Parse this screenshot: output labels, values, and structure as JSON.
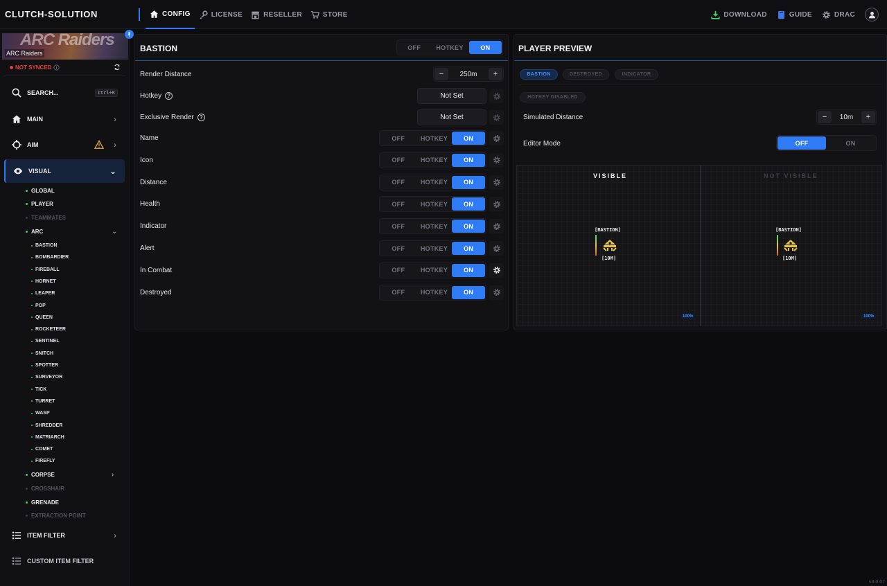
{
  "app": {
    "brand": "CLUTCH-SOLUTION",
    "version": "v3.0.07"
  },
  "nav": {
    "tabs": [
      {
        "label": "CONFIG",
        "icon": "home-icon",
        "active": true
      },
      {
        "label": "LICENSE",
        "icon": "key-icon"
      },
      {
        "label": "RESELLER",
        "icon": "store-icon"
      },
      {
        "label": "STORE",
        "icon": "cart-icon"
      }
    ],
    "right": {
      "download": "DOWNLOAD",
      "guide": "GUIDE",
      "user": "DRAC"
    }
  },
  "sidebar": {
    "game": {
      "banner_text": "ARC Raiders",
      "label": "ARC Raiders"
    },
    "sync_status": "NOT SYNCED",
    "search": {
      "label": "SEARCH...",
      "shortcut": "Ctrl+K"
    },
    "main": "MAIN",
    "aim": "AIM",
    "visual": "VISUAL",
    "visual_sub": {
      "global": "GLOBAL",
      "player": "PLAYER",
      "teammates": "TEAMMATES",
      "arc": "ARC",
      "corpse": "CORPSE",
      "crosshair": "CROSSHAIR",
      "grenade": "GRENADE",
      "extraction_point": "EXTRACTION POINT"
    },
    "arc_items": [
      "BASTION",
      "BOMBARDIER",
      "FIREBALL",
      "HORNET",
      "LEAPER",
      "POP",
      "QUEEN",
      "ROCKETEER",
      "SENTINEL",
      "SNITCH",
      "SPOTTER",
      "SURVEYOR",
      "TICK",
      "TURRET",
      "WASP",
      "SHREDDER",
      "MATRIARCH",
      "COMET",
      "FIREFLY"
    ],
    "item_filter": "ITEM FILTER",
    "custom_item_filter": "CUSTOM ITEM FILTER"
  },
  "config": {
    "title": "BASTION",
    "toggle": {
      "off": "OFF",
      "hotkey": "HOTKEY",
      "on": "ON",
      "selected": "ON"
    },
    "render_distance": {
      "label": "Render Distance",
      "value": "250m"
    },
    "hotkey": {
      "label": "Hotkey",
      "value": "Not Set"
    },
    "exclusive_render": {
      "label": "Exclusive Render",
      "value": "Not Set"
    },
    "rows": [
      {
        "label": "Name",
        "selected": "ON"
      },
      {
        "label": "Icon",
        "selected": "ON"
      },
      {
        "label": "Distance",
        "selected": "ON"
      },
      {
        "label": "Health",
        "selected": "ON"
      },
      {
        "label": "Indicator",
        "selected": "ON"
      },
      {
        "label": "Alert",
        "selected": "ON"
      },
      {
        "label": "In Combat",
        "selected": "ON"
      },
      {
        "label": "Destroyed",
        "selected": "ON"
      }
    ]
  },
  "preview": {
    "title": "PLAYER PREVIEW",
    "chips": [
      "BASTION",
      "DESTROYED",
      "INDICATOR"
    ],
    "active_chip": "BASTION",
    "hotkey_chip": "HOTKEY DISABLED",
    "simulated_distance": {
      "label": "Simulated Distance",
      "value": "10m"
    },
    "editor_mode": {
      "label": "Editor Mode",
      "off": "OFF",
      "on": "ON",
      "selected": "OFF"
    },
    "visible_title": "VISIBLE",
    "not_visible_title": "NOT VISIBLE",
    "tag_name": "[BASTION]",
    "tag_distance": "[10M]",
    "zoom": "100%"
  },
  "colors": {
    "accent": "#2f7bf5",
    "bg": "#0c0c0e",
    "panel": "#121214",
    "alert": "#e53b3b",
    "ok": "#3ad36b",
    "warn": "#e8a83a",
    "marker": "#e8c53a"
  }
}
